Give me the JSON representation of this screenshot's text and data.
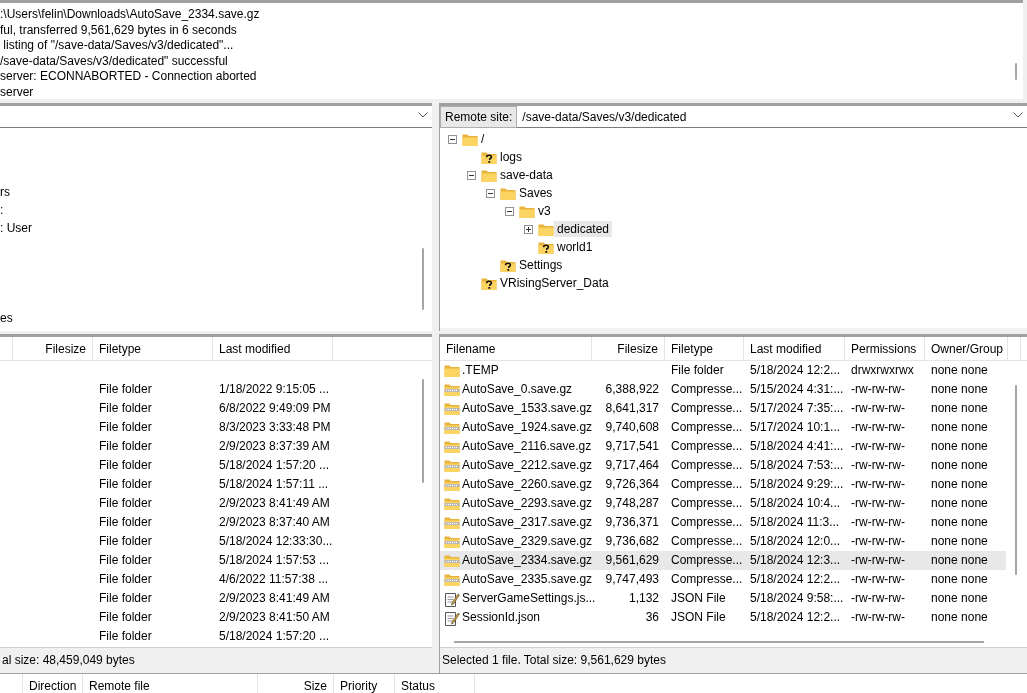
{
  "message_log": {
    "lines": [
      ":\\Users\\felin\\Downloads\\AutoSave_2334.save.gz",
      "ful, transferred 9,561,629 bytes in 6 seconds",
      " listing of \"/save-data/Saves/v3/dedicated\"...",
      "/save-data/Saves/v3/dedicated\" successful",
      "server: ECONNABORTED - Connection aborted",
      "server"
    ]
  },
  "local_site": {
    "tree_items": [
      {
        "kind": "clipped"
      },
      {
        "kind": "clipped"
      },
      {
        "kind": "clipped"
      },
      {
        "kind": "text",
        "label": "rs"
      },
      {
        "kind": "text",
        "label": ":"
      },
      {
        "kind": "text",
        "label": ": User"
      },
      {
        "kind": "clipped"
      },
      {
        "kind": "clipped"
      },
      {
        "kind": "clipped"
      },
      {
        "kind": "clipped"
      },
      {
        "kind": "text",
        "label": "es"
      }
    ]
  },
  "remote_site": {
    "label": "Remote site:",
    "path": "/save-data/Saves/v3/dedicated",
    "tree": [
      {
        "label": "/",
        "kind": "folder",
        "expanded": true,
        "selected": false,
        "children": [
          {
            "label": "logs",
            "kind": "unknown",
            "selected": false
          },
          {
            "label": "save-data",
            "kind": "folder",
            "expanded": true,
            "selected": false,
            "children": [
              {
                "label": "Saves",
                "kind": "folder",
                "expanded": true,
                "selected": false,
                "children": [
                  {
                    "label": "v3",
                    "kind": "folder",
                    "expanded": true,
                    "selected": false,
                    "children": [
                      {
                        "label": "dedicated",
                        "kind": "folder",
                        "expanded": false,
                        "selected": true
                      },
                      {
                        "label": "world1",
                        "kind": "unknown",
                        "selected": false
                      }
                    ]
                  }
                ]
              },
              {
                "label": "Settings",
                "kind": "unknown",
                "selected": false
              }
            ]
          },
          {
            "label": "VRisingServer_Data",
            "kind": "unknown",
            "selected": false
          }
        ]
      }
    ]
  },
  "local_files": {
    "columns": [
      "Filesize",
      "Filetype",
      "Last modified"
    ],
    "rows": [
      {
        "kind": "clipped"
      },
      {
        "kind": "folder",
        "filetype": "File folder",
        "last_modified": "1/18/2022 9:15:05 ..."
      },
      {
        "kind": "folder",
        "filetype": "File folder",
        "last_modified": "6/8/2022 9:49:09 PM"
      },
      {
        "kind": "folder",
        "filetype": "File folder",
        "last_modified": "8/3/2023 3:33:48 PM"
      },
      {
        "kind": "folder",
        "filetype": "File folder",
        "last_modified": "2/9/2023 8:37:39 AM"
      },
      {
        "kind": "folder",
        "filetype": "File folder",
        "last_modified": "5/18/2024 1:57:20 ..."
      },
      {
        "kind": "folder",
        "filetype": "File folder",
        "last_modified": "5/18/2024 1:57:11 ..."
      },
      {
        "kind": "folder",
        "filetype": "File folder",
        "last_modified": "2/9/2023 8:41:49 AM"
      },
      {
        "kind": "folder",
        "filetype": "File folder",
        "last_modified": "2/9/2023 8:37:40 AM"
      },
      {
        "kind": "folder",
        "filetype": "File folder",
        "last_modified": "5/18/2024 12:33:30..."
      },
      {
        "kind": "folder",
        "filetype": "File folder",
        "last_modified": "5/18/2024 1:57:53 ..."
      },
      {
        "kind": "folder",
        "filetype": "File folder",
        "last_modified": "4/6/2022 11:57:38 ..."
      },
      {
        "kind": "folder",
        "filetype": "File folder",
        "last_modified": "2/9/2023 8:41:49 AM"
      },
      {
        "kind": "folder",
        "filetype": "File folder",
        "last_modified": "2/9/2023 8:41:50 AM"
      },
      {
        "kind": "folder",
        "filetype": "File folder",
        "last_modified": "5/18/2024 1:57:20 ..."
      }
    ],
    "status": "al size: 48,459,049 bytes"
  },
  "remote_files": {
    "columns": [
      "Filename",
      "Filesize",
      "Filetype",
      "Last modified",
      "Permissions",
      "Owner/Group"
    ],
    "rows": [
      {
        "kind": "folder",
        "name": ".TEMP",
        "filetype": "File folder",
        "last_modified": "5/18/2024 12:2...",
        "permissions": "drwxrwxrwx",
        "owner": "none none",
        "selected": false
      },
      {
        "kind": "archive",
        "name": "AutoSave_0.save.gz",
        "size": "6,388,922",
        "filetype": "Compresse...",
        "last_modified": "5/15/2024 4:31:...",
        "permissions": "-rw-rw-rw-",
        "owner": "none none",
        "selected": false
      },
      {
        "kind": "archive",
        "name": "AutoSave_1533.save.gz",
        "size": "8,641,317",
        "filetype": "Compresse...",
        "last_modified": "5/17/2024 7:35:...",
        "permissions": "-rw-rw-rw-",
        "owner": "none none",
        "selected": false
      },
      {
        "kind": "archive",
        "name": "AutoSave_1924.save.gz",
        "size": "9,740,608",
        "filetype": "Compresse...",
        "last_modified": "5/17/2024 10:1...",
        "permissions": "-rw-rw-rw-",
        "owner": "none none",
        "selected": false
      },
      {
        "kind": "archive",
        "name": "AutoSave_2116.save.gz",
        "size": "9,717,541",
        "filetype": "Compresse...",
        "last_modified": "5/18/2024 4:41:...",
        "permissions": "-rw-rw-rw-",
        "owner": "none none",
        "selected": false
      },
      {
        "kind": "archive",
        "name": "AutoSave_2212.save.gz",
        "size": "9,717,464",
        "filetype": "Compresse...",
        "last_modified": "5/18/2024 7:53:...",
        "permissions": "-rw-rw-rw-",
        "owner": "none none",
        "selected": false
      },
      {
        "kind": "archive",
        "name": "AutoSave_2260.save.gz",
        "size": "9,726,364",
        "filetype": "Compresse...",
        "last_modified": "5/18/2024 9:29:...",
        "permissions": "-rw-rw-rw-",
        "owner": "none none",
        "selected": false
      },
      {
        "kind": "archive",
        "name": "AutoSave_2293.save.gz",
        "size": "9,748,287",
        "filetype": "Compresse...",
        "last_modified": "5/18/2024 10:4...",
        "permissions": "-rw-rw-rw-",
        "owner": "none none",
        "selected": false
      },
      {
        "kind": "archive",
        "name": "AutoSave_2317.save.gz",
        "size": "9,736,371",
        "filetype": "Compresse...",
        "last_modified": "5/18/2024 11:3...",
        "permissions": "-rw-rw-rw-",
        "owner": "none none",
        "selected": false
      },
      {
        "kind": "archive",
        "name": "AutoSave_2329.save.gz",
        "size": "9,736,682",
        "filetype": "Compresse...",
        "last_modified": "5/18/2024 12:0...",
        "permissions": "-rw-rw-rw-",
        "owner": "none none",
        "selected": false
      },
      {
        "kind": "archive",
        "name": "AutoSave_2334.save.gz",
        "size": "9,561,629",
        "filetype": "Compresse...",
        "last_modified": "5/18/2024 12:3...",
        "permissions": "-rw-rw-rw-",
        "owner": "none none",
        "selected": true
      },
      {
        "kind": "archive",
        "name": "AutoSave_2335.save.gz",
        "size": "9,747,493",
        "filetype": "Compresse...",
        "last_modified": "5/18/2024 12:2...",
        "permissions": "-rw-rw-rw-",
        "owner": "none none",
        "selected": false
      },
      {
        "kind": "json",
        "name": "ServerGameSettings.js...",
        "size": "1,132",
        "filetype": "JSON File",
        "last_modified": "5/18/2024 9:58:...",
        "permissions": "-rw-rw-rw-",
        "owner": "none none",
        "selected": false
      },
      {
        "kind": "json",
        "name": "SessionId.json",
        "size": "36",
        "filetype": "JSON File",
        "last_modified": "5/18/2024 12:2...",
        "permissions": "-rw-rw-rw-",
        "owner": "none none",
        "selected": false
      }
    ],
    "status": "Selected 1 file. Total size: 9,561,629 bytes"
  },
  "queue": {
    "columns": [
      "Direction",
      "Remote file",
      "Size",
      "Priority",
      "Status"
    ]
  }
}
